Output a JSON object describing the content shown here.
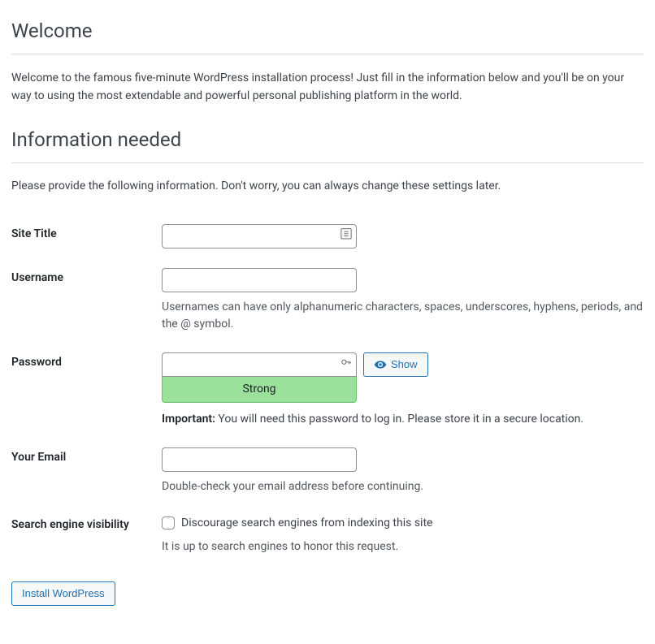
{
  "headings": {
    "welcome": "Welcome",
    "info_needed": "Information needed"
  },
  "intro_text": "Welcome to the famous five-minute WordPress installation process! Just fill in the information below and you'll be on your way to using the most extendable and powerful personal publishing platform in the world.",
  "instruction_text": "Please provide the following information. Don't worry, you can always change these settings later.",
  "form": {
    "site_title": {
      "label": "Site Title",
      "value": ""
    },
    "username": {
      "label": "Username",
      "value": "",
      "hint": "Usernames can have only alphanumeric characters, spaces, underscores, hyphens, periods, and the @ symbol."
    },
    "password": {
      "label": "Password",
      "value": "",
      "strength": "Strong",
      "show_button": "Show",
      "important_label": "Important:",
      "important_text": " You will need this password to log in. Please store it in a secure location."
    },
    "email": {
      "label": "Your Email",
      "value": "",
      "hint": "Double-check your email address before continuing."
    },
    "search_visibility": {
      "label": "Search engine visibility",
      "checkbox_label": "Discourage search engines from indexing this site",
      "hint": "It is up to search engines to honor this request."
    }
  },
  "submit_button": "Install WordPress"
}
